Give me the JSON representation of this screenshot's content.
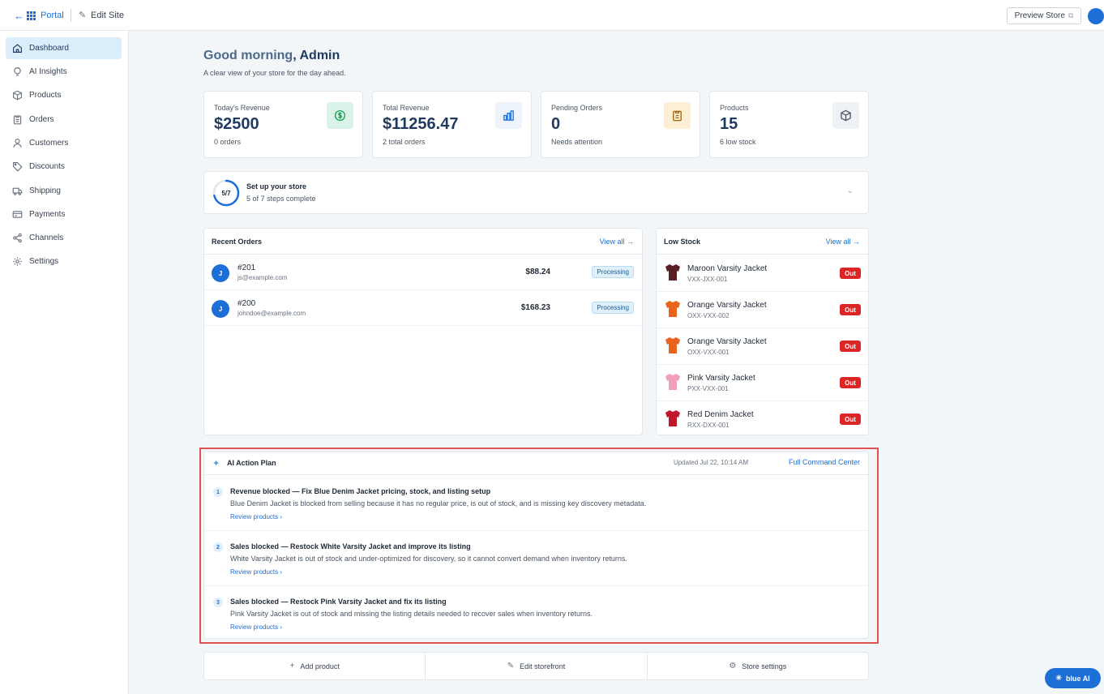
{
  "topbar": {
    "back_label": "Portal",
    "edit_label": "Edit Site",
    "preview_label": "Preview Store"
  },
  "sidebar": {
    "items": [
      {
        "label": "Dashboard",
        "icon": "home-icon",
        "active": true
      },
      {
        "label": "AI Insights",
        "icon": "lightbulb-icon",
        "active": false
      },
      {
        "label": "Products",
        "icon": "box-icon",
        "active": false
      },
      {
        "label": "Orders",
        "icon": "clipboard-icon",
        "active": false
      },
      {
        "label": "Customers",
        "icon": "user-icon",
        "active": false
      },
      {
        "label": "Discounts",
        "icon": "tag-icon",
        "active": false
      },
      {
        "label": "Shipping",
        "icon": "truck-icon",
        "active": false
      },
      {
        "label": "Payments",
        "icon": "credit-card-icon",
        "active": false
      },
      {
        "label": "Channels",
        "icon": "share-icon",
        "active": false
      },
      {
        "label": "Settings",
        "icon": "gear-icon",
        "active": false
      }
    ]
  },
  "greeting": {
    "prefix": "Good morning",
    "name": ", Admin",
    "subtitle": "A clear view of your store for the day ahead."
  },
  "stats": [
    {
      "label": "Today's Revenue",
      "value": "$2500",
      "sub": "0 orders",
      "icon": "dollar-icon"
    },
    {
      "label": "Total Revenue",
      "value": "$11256.47",
      "sub": "2 total orders",
      "icon": "bar-chart-icon"
    },
    {
      "label": "Pending Orders",
      "value": "0",
      "sub": "Needs attention",
      "icon": "clipboard-icon"
    },
    {
      "label": "Products",
      "value": "15",
      "sub": "6 low stock",
      "icon": "cube-icon"
    }
  ],
  "setup": {
    "progress_text": "5/7",
    "progress_fraction": 0.714,
    "title": "Set up your store",
    "subtitle": "5 of 7 steps complete"
  },
  "recent_orders": {
    "title": "Recent Orders",
    "view_all": "View all →",
    "rows": [
      {
        "initial": "J",
        "id": "#201",
        "email": "js@example.com",
        "amount": "$88.24",
        "status": "Processing"
      },
      {
        "initial": "J",
        "id": "#200",
        "email": "johndoe@example.com",
        "amount": "$168.23",
        "status": "Processing"
      }
    ]
  },
  "low_stock": {
    "title": "Low Stock",
    "view_all": "View all →",
    "rows": [
      {
        "name": "Maroon Varsity Jacket",
        "sku": "VXX-JXX-001",
        "badge": "Out",
        "color": "#5a1f24"
      },
      {
        "name": "Orange Varsity Jacket",
        "sku": "OXX-VXX-002",
        "badge": "Out",
        "color": "#e8641c"
      },
      {
        "name": "Orange Varsity Jacket",
        "sku": "OXX-VXX-001",
        "badge": "Out",
        "color": "#e8641c"
      },
      {
        "name": "Pink Varsity Jacket",
        "sku": "PXX-VXX-001",
        "badge": "Out",
        "color": "#f0a0b8"
      },
      {
        "name": "Red Denim Jacket",
        "sku": "RXX-DXX-001",
        "badge": "Out",
        "color": "#c0182a"
      }
    ]
  },
  "ai_plan": {
    "title": "AI Action Plan",
    "updated": "Updated Jul 22, 10:14 AM",
    "full_link": "Full Command Center",
    "items": [
      {
        "num": "1",
        "title": "Revenue blocked — Fix Blue Denim Jacket pricing, stock, and listing setup",
        "desc": "Blue Denim Jacket is blocked from selling because it has no regular price, is out of stock, and is missing key discovery metadata.",
        "link": "Review products ›"
      },
      {
        "num": "2",
        "title": "Sales blocked — Restock White Varsity Jacket and improve its listing",
        "desc": "White Varsity Jacket is out of stock and under-optimized for discovery, so it cannot convert demand when inventory returns.",
        "link": "Review products ›"
      },
      {
        "num": "3",
        "title": "Sales blocked — Restock Pink Varsity Jacket and fix its listing",
        "desc": "Pink Varsity Jacket is out of stock and missing the listing details needed to recover sales when inventory returns.",
        "link": "Review products ›"
      }
    ]
  },
  "quick_actions": [
    {
      "label": "Add product",
      "icon": "plus-icon"
    },
    {
      "label": "Edit storefront",
      "icon": "pencil-icon"
    },
    {
      "label": "Store settings",
      "icon": "gear-icon"
    }
  ],
  "assistant": {
    "label": "blue AI"
  },
  "colors": {
    "accent": "#1d6fd8",
    "danger": "#dc2626",
    "highlight": "#e05252"
  }
}
